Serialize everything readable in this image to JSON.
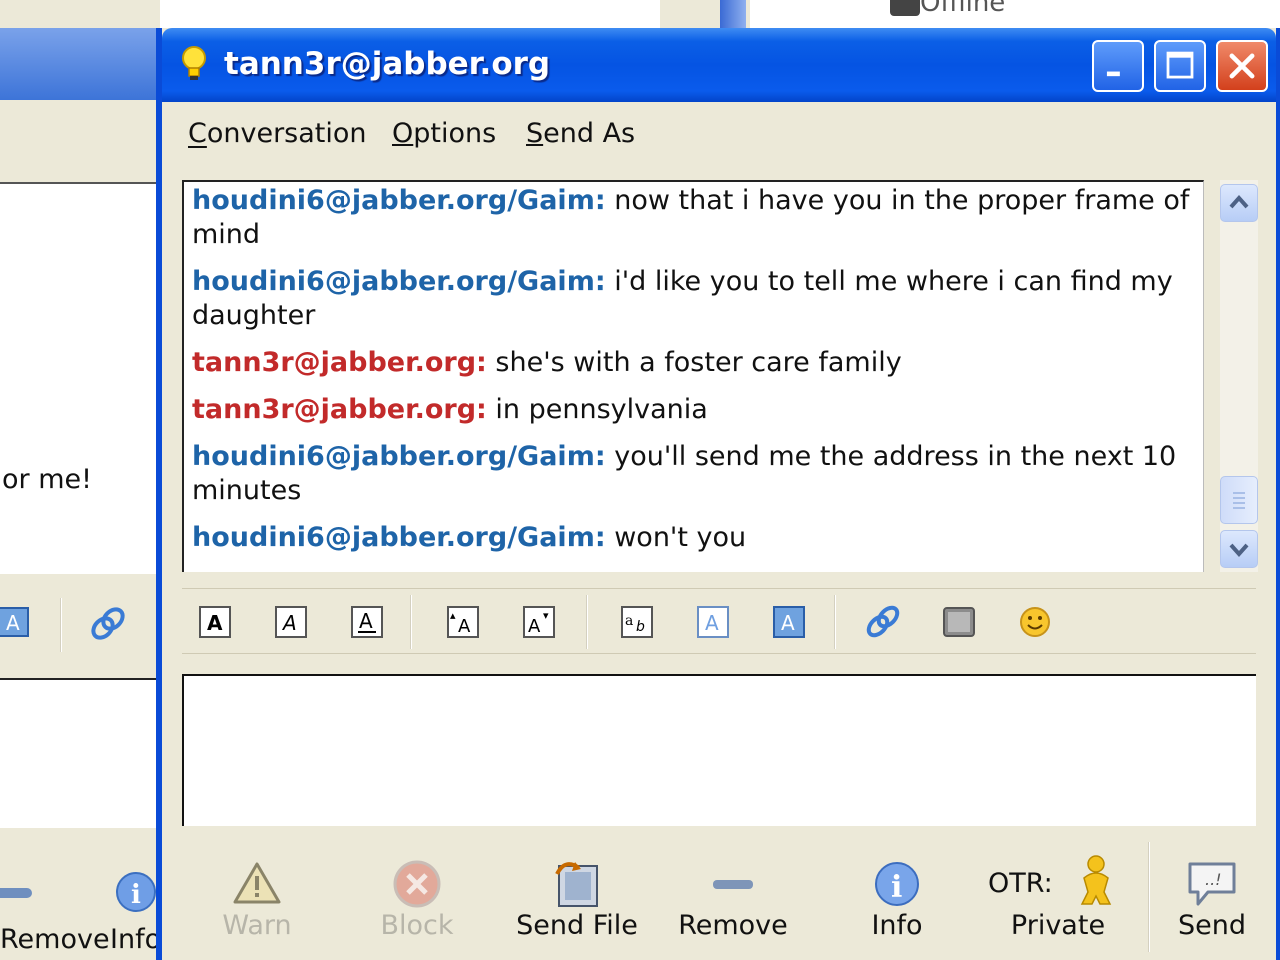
{
  "background_window": {
    "status_text": "Offline",
    "chat_fragment": "or me!",
    "buttons": [
      {
        "label": "Remove"
      },
      {
        "label": "Info"
      }
    ]
  },
  "window": {
    "title": "tann3r@jabber.org",
    "controls": {
      "minimize": "minimize",
      "maximize": "maximize",
      "close": "close"
    }
  },
  "menu": {
    "items": [
      {
        "label": "Conversation",
        "mnemonic": "C"
      },
      {
        "label": "Options",
        "mnemonic": "O"
      },
      {
        "label": "Send As",
        "mnemonic": "S"
      }
    ]
  },
  "conversation": {
    "messages": [
      {
        "sender": "houdini6@jabber.org/Gaim:",
        "text": "now that i have you in the proper frame of mind",
        "color": "#1e64a8"
      },
      {
        "sender": "houdini6@jabber.org/Gaim:",
        "text": "i'd like you to tell me where i can find my daughter",
        "color": "#1e64a8"
      },
      {
        "sender": "tann3r@jabber.org:",
        "text": "she's with a foster care family",
        "color": "#c22a2a"
      },
      {
        "sender": "tann3r@jabber.org:",
        "text": "in pennsylvania",
        "color": "#c22a2a"
      },
      {
        "sender": "houdini6@jabber.org/Gaim:",
        "text": "you'll send me the address in the next 10 minutes",
        "color": "#1e64a8"
      },
      {
        "sender": "houdini6@jabber.org/Gaim:",
        "text": "won't you",
        "color": "#1e64a8"
      }
    ]
  },
  "format_toolbar": {
    "icons": [
      "bold-icon",
      "italic-icon",
      "underline-icon",
      "larger-text-icon",
      "smaller-text-icon",
      "font-face-icon",
      "foreground-color-icon",
      "background-color-icon",
      "insert-link-icon",
      "insert-image-icon",
      "smiley-icon"
    ]
  },
  "entry": {
    "value": ""
  },
  "actions": {
    "warn": {
      "label": "Warn",
      "enabled": false
    },
    "block": {
      "label": "Block",
      "enabled": false
    },
    "send_file": {
      "label": "Send File"
    },
    "remove": {
      "label": "Remove"
    },
    "info": {
      "label": "Info"
    },
    "otr": {
      "label": "OTR:",
      "status": "Private"
    },
    "send": {
      "label": "Send"
    }
  }
}
